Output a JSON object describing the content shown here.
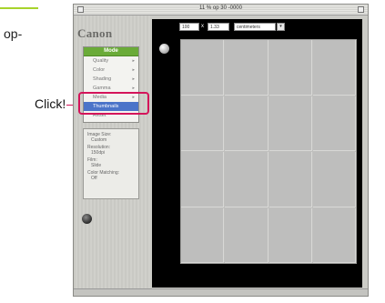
{
  "page": {
    "edge_text": "op-",
    "callout_label": "Click!"
  },
  "window": {
    "title": "11 % op 30 -0000"
  },
  "panel": {
    "logo": "Canon",
    "menu": {
      "header": "Mode",
      "items": [
        {
          "label": "Quality",
          "arrow": "▸"
        },
        {
          "label": "Color",
          "arrow": "▸"
        },
        {
          "label": "Shading",
          "arrow": "▸"
        },
        {
          "label": "Gamma",
          "arrow": "▸"
        },
        {
          "label": "Media",
          "arrow": "▸"
        },
        {
          "label": "Thumbnails",
          "arrow": ""
        },
        {
          "label": "Reset",
          "arrow": ""
        }
      ],
      "selected_index": 5
    },
    "info": [
      {
        "label": "Image Size:",
        "value": "Custom"
      },
      {
        "label": "Resolution:",
        "value": "150dpi"
      },
      {
        "label": "Film:",
        "value": "Slide"
      },
      {
        "label": "Color Matching:",
        "value": "Off"
      }
    ]
  },
  "toolbar": {
    "field1": "100",
    "separator": "x",
    "field2": "1.33",
    "unit": "centimeters",
    "unit_dropdown": "▾"
  },
  "colors": {
    "menu_header": "#6aab38",
    "selection": "#4b74c9",
    "callout": "#d4145a",
    "work_background": "#000000",
    "grid_cell": "#bebebd"
  },
  "grid": {
    "rows": 4,
    "cols": 4
  }
}
